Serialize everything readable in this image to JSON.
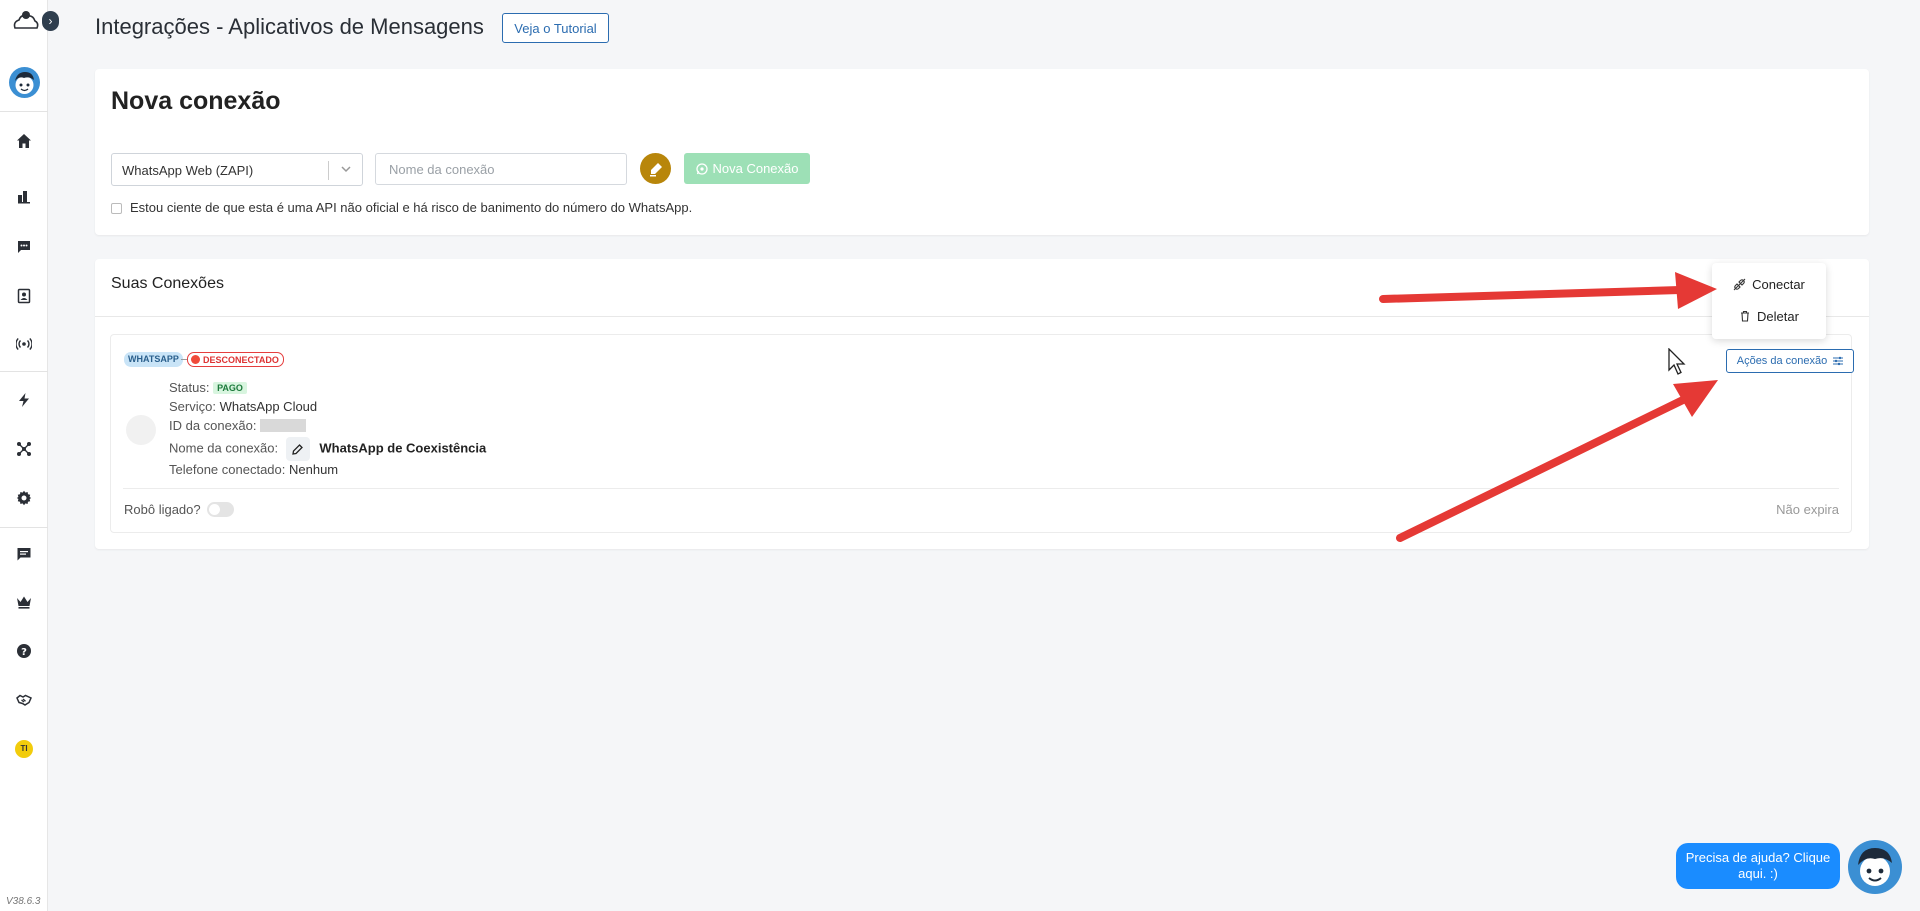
{
  "app": {
    "version": "V38.6.3",
    "toggle_glyph": "›"
  },
  "sidebar": {
    "avatar_icon": "mascot-avatar-icon",
    "badge": "TI",
    "items": [
      {
        "icon": "home-icon"
      },
      {
        "icon": "bar-chart-icon"
      },
      {
        "icon": "chat-bubble-icon"
      },
      {
        "icon": "contacts-icon"
      },
      {
        "icon": "broadcast-icon"
      },
      {
        "icon": "lightning-icon"
      },
      {
        "icon": "network-icon"
      },
      {
        "icon": "gear-icon"
      },
      {
        "icon": "message-icon"
      },
      {
        "icon": "crown-icon"
      },
      {
        "icon": "help-icon"
      },
      {
        "icon": "handshake-icon"
      }
    ]
  },
  "header": {
    "title": "Integrações - Aplicativos de Mensagens",
    "tutorial_label": "Veja o Tutorial"
  },
  "new_connection": {
    "title": "Nova conexão",
    "select_value": "WhatsApp Web (ZAPI)",
    "name_placeholder": "Nome da conexão",
    "button_label": "Nova Conexão",
    "checkbox_label": "Estou ciente de que esta é uma API não oficial e há risco de banimento do número do WhatsApp."
  },
  "connections": {
    "title": "Suas Conexões",
    "actions_label": "Ações da conexão",
    "menu": [
      {
        "label": "Conectar",
        "icon": "plug-off-icon"
      },
      {
        "label": "Deletar",
        "icon": "trash-icon"
      }
    ],
    "item": {
      "tag_platform": "WHATSAPP",
      "tag_status": "DESCONECTADO",
      "status_label": "Status:",
      "status_value": "PAGO",
      "service_label": "Serviço:",
      "service_value": "WhatsApp Cloud",
      "id_label": "ID da conexão:",
      "name_label": "Nome da conexão:",
      "name_value": "WhatsApp de Coexistência",
      "phone_label": "Telefone conectado:",
      "phone_value": "Nenhum",
      "robot_label": "Robô ligado?",
      "expiry": "Não expira"
    }
  },
  "help": {
    "label": "Precisa de ajuda? Clique aqui. :)"
  },
  "colors": {
    "primary": "#2b6cb0",
    "success_light": "#9de0b6",
    "danger": "#e53e3e",
    "annotation_arrow": "#e53935",
    "help_blue": "#1a8cff"
  }
}
